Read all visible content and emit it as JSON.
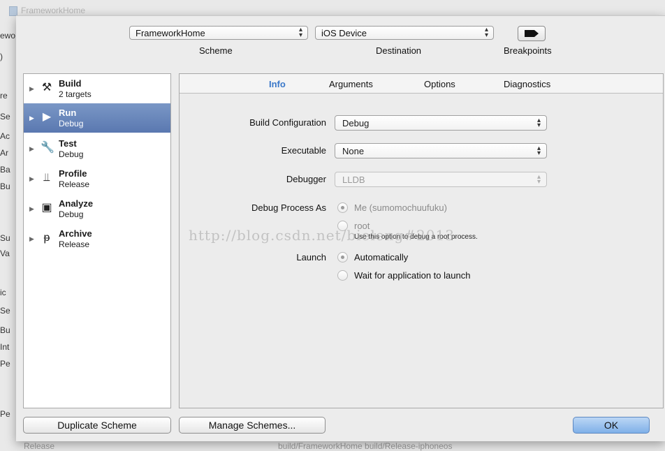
{
  "background": {
    "window_title": "FrameworkHome",
    "left_fragments": [
      "ewo",
      ")",
      "re",
      "Se",
      "Ac",
      "Ar",
      "Ba",
      "Bu",
      "Su",
      "Va",
      "ic",
      "Se",
      "Bu",
      "Int",
      "Pe",
      "Pe"
    ],
    "bottom_fragments": [
      "Release",
      "build/FrameworkHome build/Release-iphoneos"
    ]
  },
  "header": {
    "scheme_value": "FrameworkHome",
    "destination_value": "iOS Device",
    "scheme_label": "Scheme",
    "destination_label": "Destination",
    "breakpoints_label": "Breakpoints"
  },
  "actions": [
    {
      "name": "Build",
      "sub": "2 targets",
      "icon": "hammer-icon",
      "glyph": "⚒"
    },
    {
      "name": "Run",
      "sub": "Debug",
      "icon": "play-icon",
      "glyph": "▶"
    },
    {
      "name": "Test",
      "sub": "Debug",
      "icon": "wrench-icon",
      "glyph": "🔧"
    },
    {
      "name": "Profile",
      "sub": "Release",
      "icon": "profile-icon",
      "glyph": "⫫"
    },
    {
      "name": "Analyze",
      "sub": "Debug",
      "icon": "analyze-icon",
      "glyph": "▣"
    },
    {
      "name": "Archive",
      "sub": "Release",
      "icon": "archive-icon",
      "glyph": "ᵽ"
    }
  ],
  "tabs": [
    "Info",
    "Arguments",
    "Options",
    "Diagnostics"
  ],
  "info": {
    "build_config_label": "Build Configuration",
    "build_config_value": "Debug",
    "executable_label": "Executable",
    "executable_value": "None",
    "debugger_label": "Debugger",
    "debugger_value": "LLDB",
    "debug_process_label": "Debug Process As",
    "me_option": "Me (sumomochuufuku)",
    "root_option": "root",
    "root_hint": "Use this option to debug a root process.",
    "launch_label": "Launch",
    "auto_option": "Automatically",
    "wait_option": "Wait for application to launch"
  },
  "watermark": "http://blog.csdn.net/bieleng#2013",
  "buttons": {
    "duplicate": "Duplicate Scheme",
    "manage": "Manage Schemes...",
    "ok": "OK"
  },
  "colors": {
    "selected_row": "#5a78b0",
    "tab_active": "#3a78c9",
    "ok_button": "#7fb0e8"
  }
}
